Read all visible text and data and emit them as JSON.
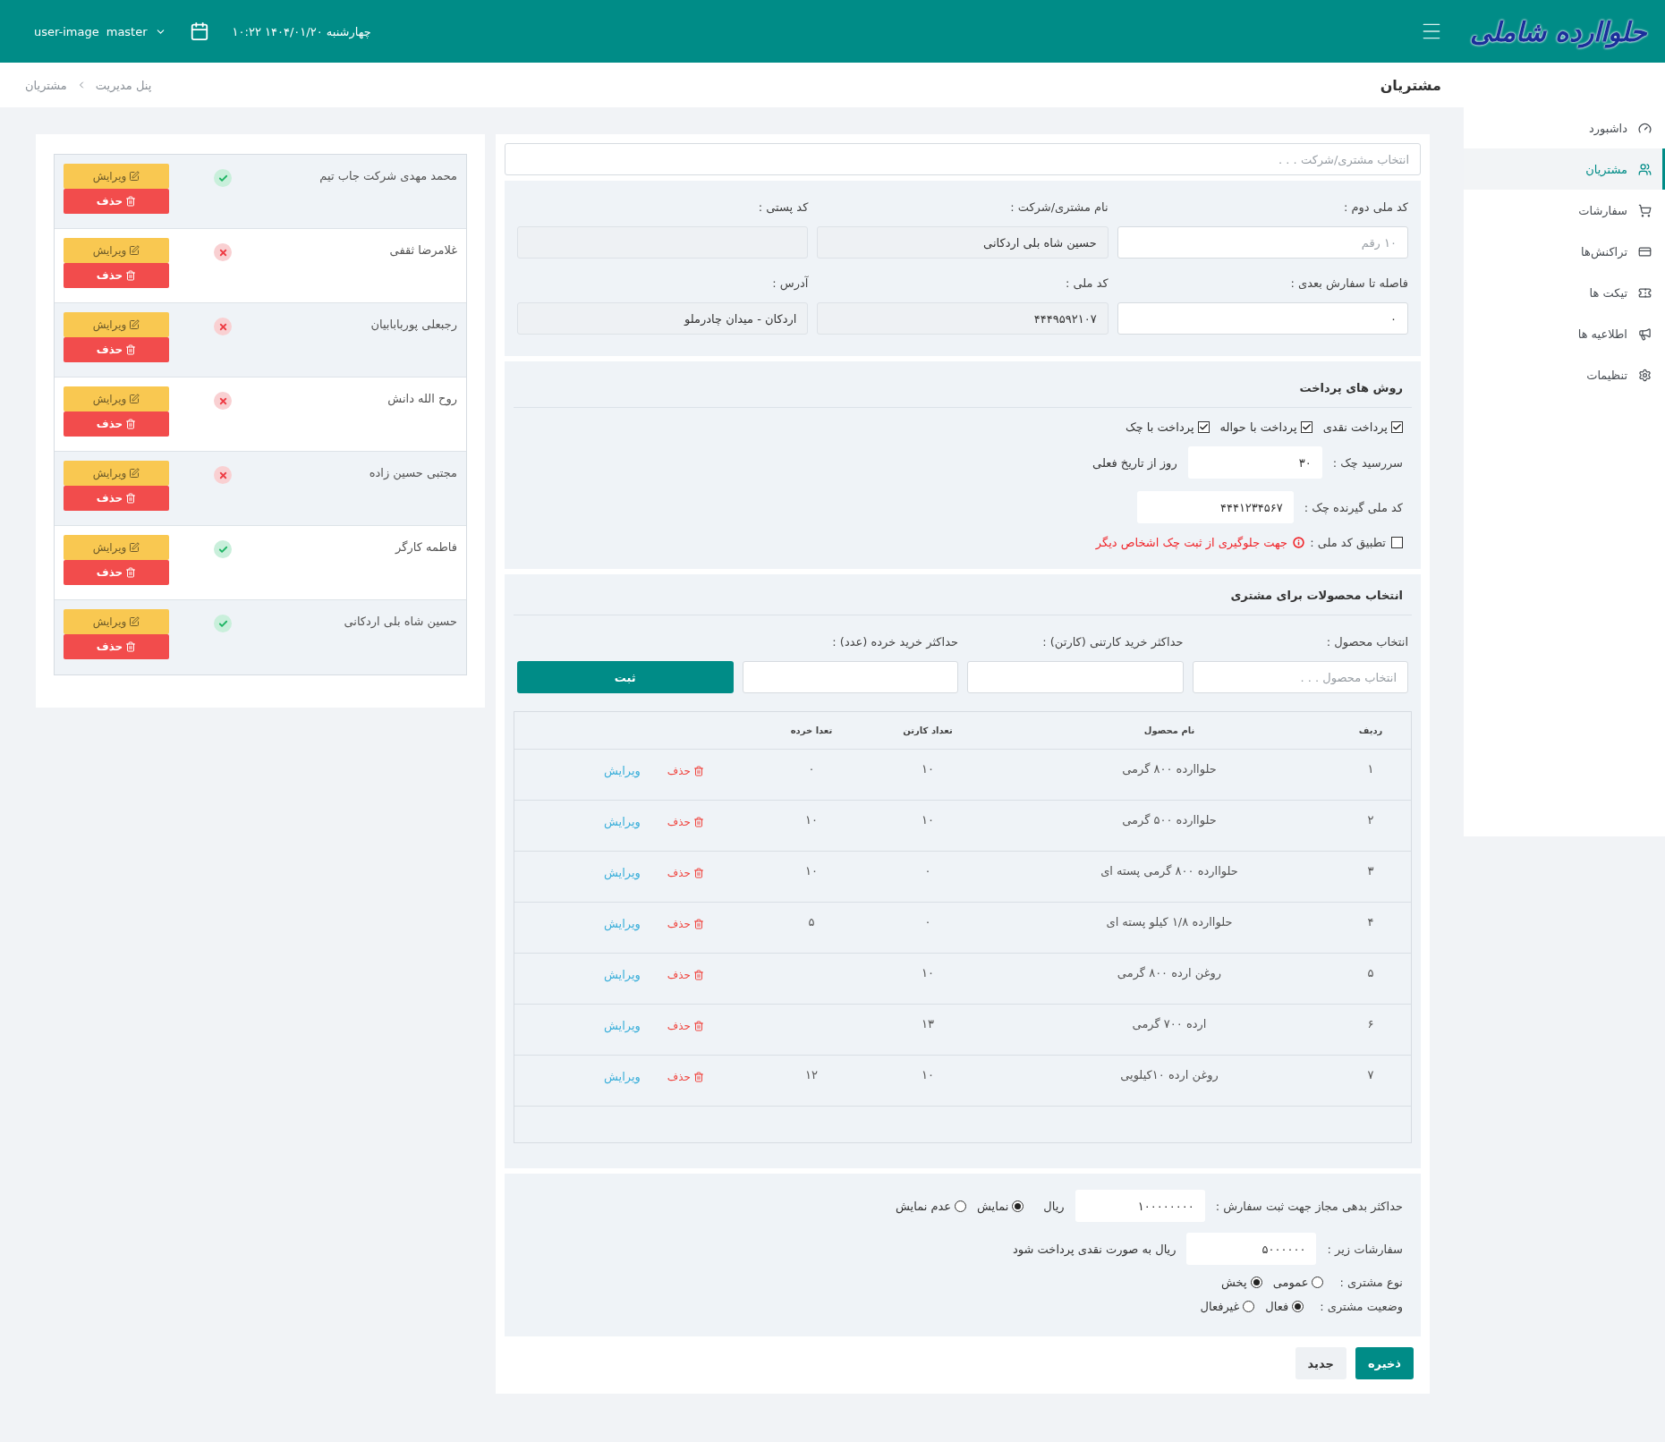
{
  "header": {
    "logo": "حلواارده شاملی",
    "user": "user-image",
    "branch": "master",
    "datetime": "چهارشنبه ۱۴۰۴/۰۱/۲۰ ۱۰:۲۲"
  },
  "page": {
    "title": "مشتریان",
    "breadcrumb": [
      "پنل مدیریت",
      "مشتریان"
    ]
  },
  "sidebar": {
    "items": [
      {
        "label": "داشبورد",
        "selected": false
      },
      {
        "label": "مشتریان",
        "selected": true
      },
      {
        "label": "سفارشات",
        "selected": false
      },
      {
        "label": "تراکنش‌ها",
        "selected": false
      },
      {
        "label": "تیکت ها",
        "selected": false
      },
      {
        "label": "اطلاعیه ها",
        "selected": false
      },
      {
        "label": "تنظیمات",
        "selected": false
      }
    ]
  },
  "customer_select": {
    "placeholder": "انتخاب مشتری/شرکت . . ."
  },
  "details": {
    "fields": [
      {
        "label": "کد ملی دوم :",
        "placeholder": "۱۰ رقم",
        "disabled": false
      },
      {
        "label": "نام مشتری/شرکت :",
        "value": "حسین شاه بلی اردکانی",
        "disabled": true
      },
      {
        "label": "کد پستی :",
        "disabled": true
      },
      {
        "label": "فاصله تا سفارش بعدی :",
        "value": "۰",
        "disabled": false
      },
      {
        "label": "کد ملی :",
        "value": "۴۴۴۹۵۹۲۱۰۷",
        "disabled": true
      },
      {
        "label": "آدرس :",
        "value": "اردکان - میدان چادرملو",
        "disabled": true
      }
    ]
  },
  "payment": {
    "title": "روش های پرداخت",
    "methods": [
      {
        "label": "پرداخت نقدی",
        "checked": true
      },
      {
        "label": "پرداخت با حواله",
        "checked": true
      },
      {
        "label": "پرداخت با چک",
        "checked": true
      }
    ],
    "due": {
      "label": "سررسید چک :",
      "value": "۳۰",
      "suffix": "روز از تاریخ فعلی"
    },
    "receiver": {
      "label": "کد ملی گیرنده چک :",
      "value": "۴۴۴۱۲۳۴۵۶۷"
    },
    "match": {
      "label": "تطبیق کد ملی :",
      "checked": false,
      "note": "جهت جلوگیری از ثبت چک اشخاص دیگر"
    }
  },
  "products": {
    "title": "انتخاب محصولات برای مشتری",
    "fields": [
      {
        "label": "انتخاب محصول :",
        "placeholder": "انتخاب محصول . . ."
      },
      {
        "label": "حداکثر خرید کارتنی (کارتن) :"
      },
      {
        "label": "حداکثر خرید خرده (عدد) :"
      }
    ],
    "submit": "ثبت",
    "table": {
      "columns": [
        "ردیف",
        "نام محصول",
        "تعداد کارتن",
        "تعدا خرده"
      ],
      "rows": [
        {
          "index": "۱",
          "name": "حلواارده ۸۰۰ گرمی",
          "cartons": "۱۰",
          "units": "۰",
          "delete": "حذف",
          "edit": "ویرایش"
        },
        {
          "index": "۲",
          "name": "حلواارده ۵۰۰ گرمی",
          "cartons": "۱۰",
          "units": "۱۰",
          "delete": "حذف",
          "edit": "ویرایش"
        },
        {
          "index": "۳",
          "name": "حلواارده ۸۰۰ گرمی پسته ای",
          "cartons": "۰",
          "units": "۱۰",
          "delete": "حذف",
          "edit": "ویرایش"
        },
        {
          "index": "۴",
          "name": "حلواارده ۱/۸ کیلو پسته ای",
          "cartons": "۰",
          "units": "۵",
          "delete": "حذف",
          "edit": "ویرایش"
        },
        {
          "index": "۵",
          "name": "روغن ارده ۸۰۰ گرمی",
          "cartons": "۱۰",
          "delete": "حذف",
          "edit": "ویرایش"
        },
        {
          "index": "۶",
          "name": "ارده ۷۰۰ گرمی",
          "cartons": "۱۳",
          "delete": "حذف",
          "edit": "ویرایش"
        },
        {
          "index": "۷",
          "name": "روغن ارده ۱۰کیلویی",
          "cartons": "۱۰",
          "units": "۱۲",
          "delete": "حذف",
          "edit": "ویرایش"
        }
      ]
    }
  },
  "limits": {
    "debt": {
      "label": "حداکثر بدهی مجاز جهت ثبت سفارش :",
      "value": "۱۰۰۰۰۰۰۰۰",
      "unit": "ریال",
      "options": [
        {
          "label": "نمایش",
          "selected": true
        },
        {
          "label": "عدم نمایش",
          "selected": false
        }
      ]
    },
    "cash": {
      "label": "سفارشات زیر :",
      "value": "۵۰۰۰۰۰۰",
      "suffix": "ریال به صورت نقدی پرداخت شود"
    },
    "customer_type": {
      "label": "نوع مشتری :",
      "options": [
        {
          "label": "عمومی",
          "selected": false
        },
        {
          "label": "پخش",
          "selected": true
        }
      ]
    },
    "customer_status": {
      "label": "وضعیت مشتری :",
      "options": [
        {
          "label": "فعال",
          "selected": true
        },
        {
          "label": "غیرفعال",
          "selected": false
        }
      ]
    }
  },
  "actions": [
    {
      "label": "ذخیره",
      "kind": "primary"
    },
    {
      "label": "جدید",
      "kind": "secondary"
    }
  ],
  "customers": [
    {
      "name": "محمد مهدی شرکت جاب تیم",
      "active": true,
      "edit": "ویرایش",
      "delete": "حذف"
    },
    {
      "name": "غلامرضا ثقفی",
      "active": false,
      "edit": "ویرایش",
      "delete": "حذف"
    },
    {
      "name": "رجبعلی پوربابابیان",
      "active": false,
      "edit": "ویرایش",
      "delete": "حذف"
    },
    {
      "name": "روح الله دانش",
      "active": false,
      "edit": "ویرایش",
      "delete": "حذف"
    },
    {
      "name": "مجتبی حسین زاده",
      "active": false,
      "edit": "ویرایش",
      "delete": "حذف"
    },
    {
      "name": "فاطمه کارگر",
      "active": true,
      "edit": "ویرایش",
      "delete": "حذف"
    },
    {
      "name": "حسین شاه بلی اردکانی",
      "active": true,
      "edit": "ویرایش",
      "delete": "حذف"
    }
  ]
}
